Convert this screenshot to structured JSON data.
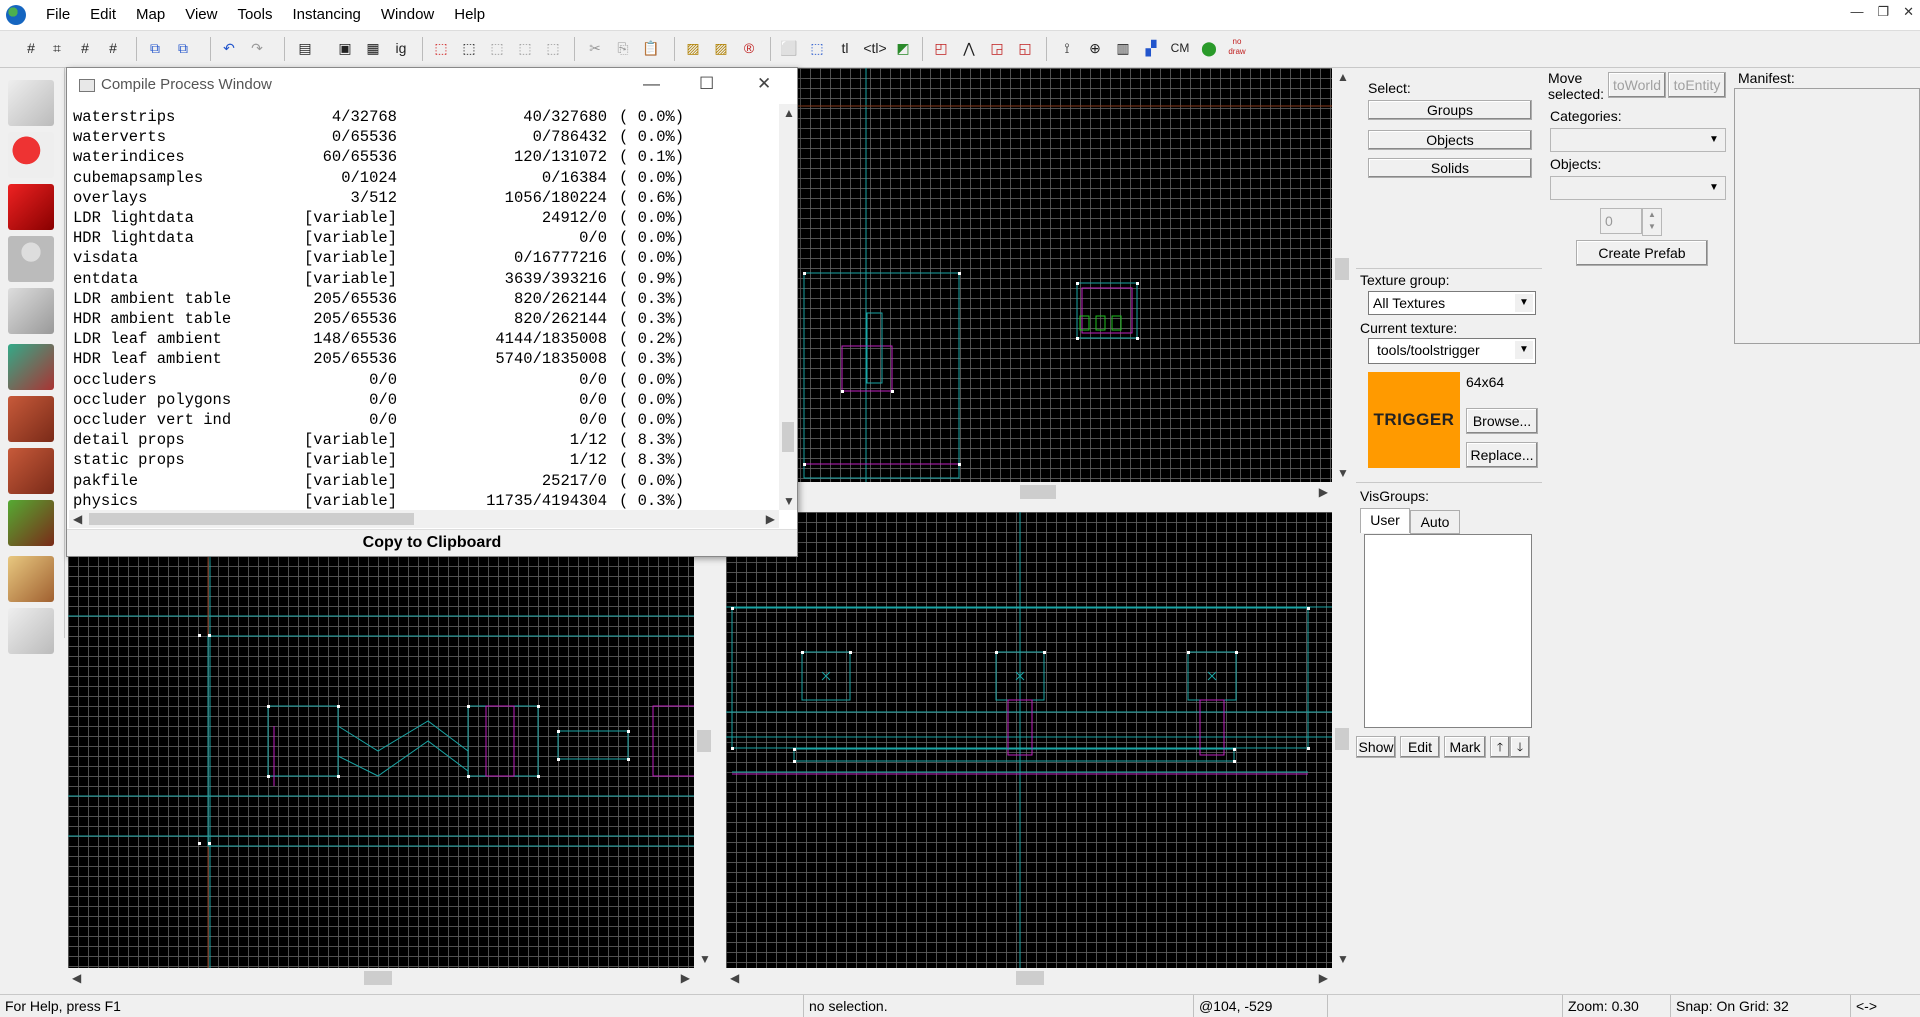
{
  "menubar": {
    "items": [
      "File",
      "Edit",
      "Map",
      "View",
      "Tools",
      "Instancing",
      "Window",
      "Help"
    ]
  },
  "toolbar": {
    "text_buttons": {
      "ig": "ig",
      "tl": "tl",
      "tlplus": "<tl>",
      "cm": "CM",
      "nodraw": "no draw"
    }
  },
  "compile_window": {
    "title": "Compile Process Window",
    "rows": [
      [
        "waterstrips",
        "4/32768",
        "40/327680",
        "( 0.0%)"
      ],
      [
        "waterverts",
        "0/65536",
        "0/786432",
        "( 0.0%)"
      ],
      [
        "waterindices",
        "60/65536",
        "120/131072",
        "( 0.1%)"
      ],
      [
        "cubemapsamples",
        "0/1024",
        "0/16384",
        "( 0.0%)"
      ],
      [
        "overlays",
        "3/512",
        "1056/180224",
        "( 0.6%)"
      ],
      [
        "LDR lightdata",
        "[variable]",
        "24912/0",
        "( 0.0%)"
      ],
      [
        "HDR lightdata",
        "[variable]",
        "0/0",
        "( 0.0%)"
      ],
      [
        "visdata",
        "[variable]",
        "0/16777216",
        "( 0.0%)"
      ],
      [
        "entdata",
        "[variable]",
        "3639/393216",
        "( 0.9%)"
      ],
      [
        "LDR ambient table",
        "205/65536",
        "820/262144",
        "( 0.3%)"
      ],
      [
        "HDR ambient table",
        "205/65536",
        "820/262144",
        "( 0.3%)"
      ],
      [
        "LDR leaf ambient",
        "148/65536",
        "4144/1835008",
        "( 0.2%)"
      ],
      [
        "HDR leaf ambient",
        "205/65536",
        "5740/1835008",
        "( 0.3%)"
      ],
      [
        "occluders",
        "0/0",
        "0/0",
        "( 0.0%)"
      ],
      [
        "occluder polygons",
        "0/0",
        "0/0",
        "( 0.0%)"
      ],
      [
        "occluder vert ind",
        "0/0",
        "0/0",
        "( 0.0%)"
      ],
      [
        "detail props",
        "[variable]",
        "1/12",
        "( 8.3%)"
      ],
      [
        "static props",
        "[variable]",
        "1/12",
        "( 8.3%)"
      ],
      [
        "pakfile",
        "[variable]",
        "25217/0",
        "( 0.0%)"
      ],
      [
        "physics",
        "[variable]",
        "11735/4194304",
        "( 0.3%)"
      ]
    ],
    "copy_button": "Copy to Clipboard"
  },
  "select_panel": {
    "label": "Select:",
    "groups": "Groups",
    "objects": "Objects",
    "solids": "Solids"
  },
  "move_panel": {
    "label_line1": "Move",
    "label_line2": "selected:",
    "to_world": "toWorld",
    "to_entity": "toEntity",
    "categories_label": "Categories:",
    "objects_label": "Objects:",
    "spinner_value": "0",
    "create_prefab": "Create Prefab"
  },
  "manifest": {
    "label": "Manifest:"
  },
  "texture_panel": {
    "group_label": "Texture group:",
    "group_value": "All Textures",
    "current_label": "Current texture:",
    "current_value": "tools/toolstrigger",
    "preview_text": "TRIGGER",
    "size": "64x64",
    "browse": "Browse...",
    "replace": "Replace..."
  },
  "visgroups": {
    "label": "VisGroups:",
    "tab_user": "User",
    "tab_auto": "Auto",
    "show": "Show",
    "edit": "Edit",
    "mark": "Mark",
    "up": "🡑",
    "down": "🡓"
  },
  "statusbar": {
    "help": "For Help, press F1",
    "selection": "no selection.",
    "coords": "@104, -529",
    "zoom": "Zoom: 0.30",
    "snap": "Snap: On Grid: 32",
    "arrows": "<->"
  },
  "colors": {
    "viewport_bg": "#000000",
    "grid": "#5f5f5f",
    "cyan_lines": "#1aa6a6",
    "magenta": "#c020c0",
    "trigger_orange": "#ff9a00"
  }
}
